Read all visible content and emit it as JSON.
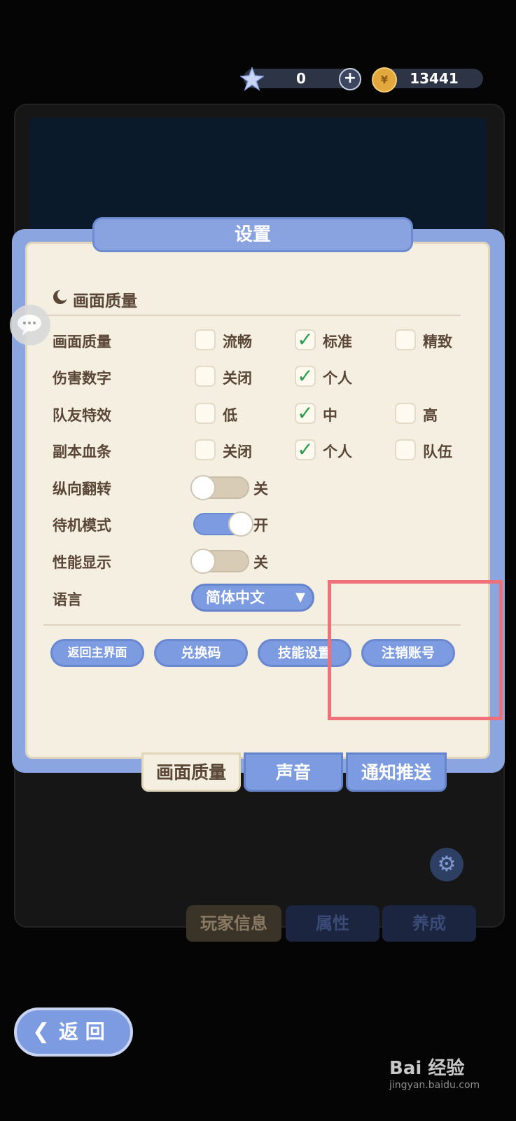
{
  "top_bar": {
    "gems": "0",
    "plus": "+",
    "coins": "13441"
  },
  "dialog": {
    "title": "设置",
    "section_title": "画面质量",
    "rows": [
      {
        "label": "画面质量",
        "options": [
          {
            "text": "流畅",
            "checked": false
          },
          {
            "text": "标准",
            "checked": true
          },
          {
            "text": "精致",
            "checked": false
          }
        ]
      },
      {
        "label": "伤害数字",
        "options": [
          {
            "text": "关闭",
            "checked": false
          },
          {
            "text": "个人",
            "checked": true
          }
        ]
      },
      {
        "label": "队友特效",
        "options": [
          {
            "text": "低",
            "checked": false
          },
          {
            "text": "中",
            "checked": true
          },
          {
            "text": "高",
            "checked": false
          }
        ]
      },
      {
        "label": "副本血条",
        "options": [
          {
            "text": "关闭",
            "checked": false
          },
          {
            "text": "个人",
            "checked": true
          },
          {
            "text": "队伍",
            "checked": false
          }
        ]
      }
    ],
    "toggles": [
      {
        "label": "纵向翻转",
        "state": "关",
        "on": false
      },
      {
        "label": "待机模式",
        "state": "开",
        "on": true
      },
      {
        "label": "性能显示",
        "state": "关",
        "on": false
      }
    ],
    "language": {
      "label": "语言",
      "value": "简体中文",
      "arrow": "▼"
    },
    "buttons": {
      "home": "返回主界面",
      "redeem": "兑换码",
      "skills": "技能设置",
      "logout": "注销账号"
    },
    "tabs": {
      "quality": "画面质量",
      "sound": "声音",
      "push": "通知推送"
    }
  },
  "background": {
    "tabs": {
      "player": "玩家信息",
      "attr": "属性",
      "grow": "养成"
    }
  },
  "back_button": {
    "label": "返 回"
  },
  "watermark": {
    "brand": "Bai 经验",
    "url": "jingyan.baidu.com"
  },
  "colors": {
    "accent": "#7c9be0",
    "highlight": "#ee7078",
    "panel": "#f4efe1",
    "text": "#5a4636"
  }
}
